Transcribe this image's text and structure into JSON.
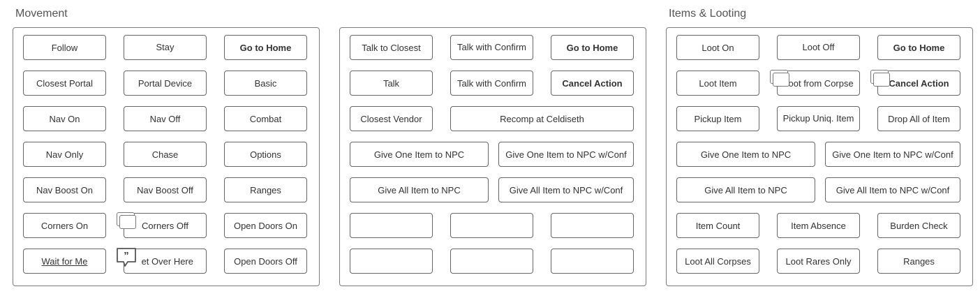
{
  "movement": {
    "title": "Movement",
    "buttons": [
      "Follow",
      "Stay",
      "Go to Home",
      "Closest Portal",
      "Portal Device",
      "Basic",
      "Nav On",
      "Nav Off",
      "Combat",
      "Nav Only",
      "Chase",
      "Options",
      "Nav Boost On",
      "Nav Boost Off",
      "Ranges",
      "Corners On",
      "Corners Off",
      "Open Doors On",
      "Wait for Me",
      "et Over Here",
      "Open Doors Off"
    ]
  },
  "npc": {
    "buttons": [
      "Talk to Closest",
      "Talk with Confirm",
      "Go to Home",
      "Talk",
      "Talk with Confirm",
      "Cancel Action",
      "Closest Vendor",
      "Recomp at Celdiseth",
      "Give One Item to NPC",
      "Give One Item to NPC w/Conf",
      "Give All Item to NPC",
      "Give All Item to NPC w/Conf"
    ]
  },
  "looting": {
    "title": "Items & Looting",
    "buttons": [
      "Loot On",
      "Loot Off",
      "Go to Home",
      "Loot Item",
      "Loot from Corpse",
      "Cancel Action",
      "Pickup Item",
      "Pickup Uniq. Item",
      "Drop All of Item",
      "Give One Item to NPC",
      "Give One Item to NPC w/Conf",
      "Give All Item to NPC",
      "Give All Item to NPC w/Conf",
      "Item Count",
      "Item Absence",
      "Burden Check",
      "Loot All Corpses",
      "Loot Rares Only",
      "Ranges"
    ]
  },
  "icons": {
    "stack": "stacked-cards-icon",
    "comment": "comment-quote-icon"
  }
}
